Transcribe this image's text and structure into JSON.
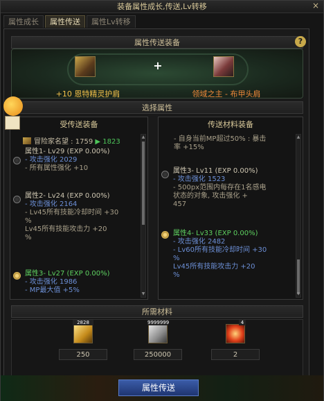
{
  "window": {
    "title": "装备属性成长,传送,Lv转移",
    "close": "×"
  },
  "tabs": [
    {
      "label": "属性成长"
    },
    {
      "label": "属性传送"
    },
    {
      "label": "属性Lv转移"
    }
  ],
  "header": {
    "title": "属性传送装备",
    "help": "?"
  },
  "banner": {
    "plus": "+",
    "source_item": "+10 恩特精灵护肩",
    "target_item": "领域之主 - 布甲头肩"
  },
  "select_section": {
    "title": "选择属性"
  },
  "left_panel": {
    "title": "受传送装备",
    "fame_label": "冒险家名望 : 1759",
    "fame_new": "1823",
    "options": [
      {
        "title": "属性1- Lv29 (EXP 0.00%)",
        "lines": [
          "- 攻击强化 2029",
          "- 所有属性强化 +10"
        ],
        "selected": false
      },
      {
        "title": "属性2- Lv24 (EXP 0.00%)",
        "lines": [
          "- 攻击强化 2164",
          "- Lv45所有技能冷却时间 +30",
          "%",
          "  Lv45所有技能攻击力 +20",
          "%"
        ],
        "selected": false
      },
      {
        "title": "属性3- Lv27 (EXP 0.00%)",
        "lines": [
          "- 攻击强化 1986",
          "- MP最大值 +5%"
        ],
        "selected": true
      }
    ]
  },
  "right_panel": {
    "title": "传送材料装备",
    "top_lines": [
      "- 自身当前MP超过50% : 暴击",
      "  率 +15%"
    ],
    "options": [
      {
        "title": "属性3- Lv11 (EXP 0.00%)",
        "lines": [
          "- 攻击强化 1523",
          "- 500px范围内每存在1名感电",
          "  状态的对象, 攻击强化 +",
          "  457"
        ],
        "selected": false
      },
      {
        "title": "属性4- Lv33 (EXP 0.00%)",
        "lines": [
          "- 攻击强化 2482",
          "- Lv60所有技能冷却时间 +30",
          "  %",
          "  Lv45所有技能攻击力 +20",
          "  %"
        ],
        "selected": true
      }
    ]
  },
  "materials": {
    "title": "所需材料",
    "items": [
      {
        "icon": "gold-crystal-icon",
        "badge": "2828",
        "value": "250"
      },
      {
        "icon": "coin-stack-icon",
        "badge": "9999999",
        "value": "250000"
      },
      {
        "icon": "red-gem-icon",
        "badge": "4",
        "value": "2"
      }
    ]
  },
  "footer": {
    "button": "属性传送"
  }
}
